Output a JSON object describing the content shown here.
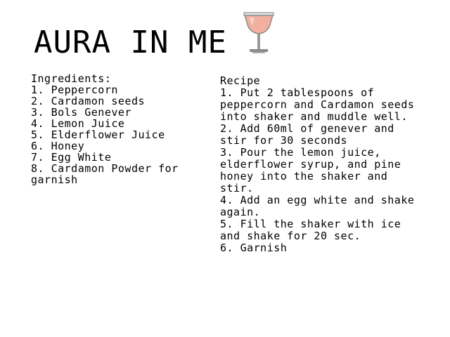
{
  "title": "AURA IN ME",
  "icons": {
    "glass": "cocktail-glass-icon"
  },
  "colors": {
    "drink": "#f2b09f",
    "glass_outline": "#7a7a7a",
    "background": "#ffffff",
    "text": "#000000"
  },
  "ingredients": {
    "heading": "Ingredients:",
    "items": [
      "1. Peppercorn",
      "2. Cardamon seeds",
      "3. Bols Genever",
      "4. Lemon Juice",
      "5. Elderflower Juice",
      "6. Honey",
      "7. Egg White",
      "8. Cardamon Powder for garnish"
    ]
  },
  "recipe": {
    "heading": "Recipe",
    "steps": [
      "1. Put 2 tablespoons of peppercorn and Cardamon seeds into shaker and muddle well.",
      "2. Add 60ml of genever and stir for 30 seconds",
      "3. Pour the lemon juice, elderflower syrup, and pine honey into the shaker and  stir.",
      "4. Add an egg white and shake again.",
      "5. Fill the shaker with ice and shake for 20 sec.",
      "6. Garnish"
    ]
  }
}
